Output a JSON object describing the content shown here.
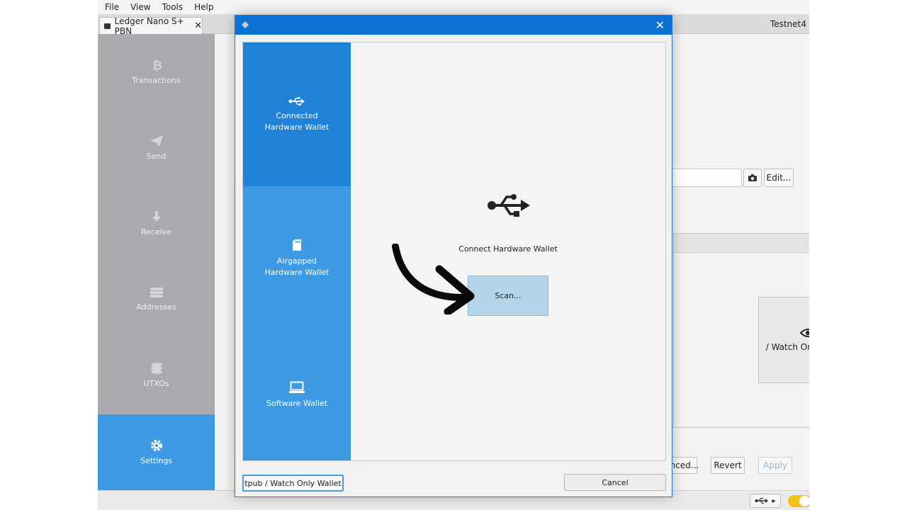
{
  "menubar": {
    "items": [
      "File",
      "View",
      "Tools",
      "Help"
    ]
  },
  "tab": {
    "label": "Ledger Nano S+ PBN",
    "close": "✕"
  },
  "network": "Testnet4",
  "sidebar": {
    "items": [
      {
        "label": "Transactions",
        "icon": "bitcoin-icon"
      },
      {
        "label": "Send",
        "icon": "send-icon"
      },
      {
        "label": "Receive",
        "icon": "receive-icon"
      },
      {
        "label": "Addresses",
        "icon": "addresses-icon"
      },
      {
        "label": "UTXOs",
        "icon": "coins-icon"
      },
      {
        "label": "Settings",
        "icon": "gear-icon"
      }
    ],
    "active": "Settings"
  },
  "background": {
    "edit_label": "Edit...",
    "card_label": "/ Watch Only Wallet",
    "advanced_label": "nced...",
    "revert_label": "Revert",
    "apply_label": "Apply"
  },
  "dialog": {
    "close": "✕",
    "sidebar": [
      {
        "label": "Connected Hardware Wallet",
        "icon": "usb-icon"
      },
      {
        "label": "Airgapped Hardware Wallet",
        "icon": "sd-card-icon"
      },
      {
        "label": "Software Wallet",
        "icon": "laptop-icon"
      }
    ],
    "active": "Connected Hardware Wallet",
    "pane_label": "Connect Hardware Wallet",
    "scan_label": "Scan...",
    "xpub_label": "tpub / Watch Only Wallet",
    "cancel_label": "Cancel"
  },
  "colors": {
    "accent": "#3d9ae3",
    "accent_dark": "#1f82d7",
    "title_bar": "#0b72d4",
    "scan": "#b4d4ea"
  }
}
